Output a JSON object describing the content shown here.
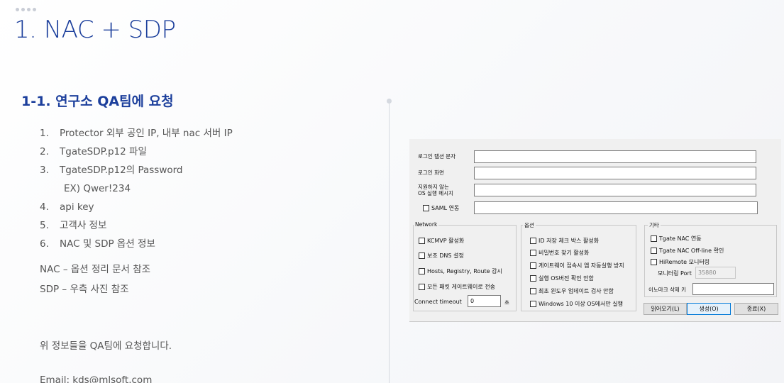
{
  "header": {
    "title": "1. NAC + SDP",
    "subtitle": "1-1. 연구소 QA팀에 요청"
  },
  "list": [
    {
      "num": "1.",
      "text": "Protector 외부 공인 IP, 내부 nac 서버 IP"
    },
    {
      "num": "2.",
      "text": "TgateSDP.p12 파일"
    },
    {
      "num": "3.",
      "text": "TgateSDP.p12의 Password"
    },
    {
      "num": "",
      "text": "EX) Qwer!234"
    },
    {
      "num": "4.",
      "text": "api key"
    },
    {
      "num": "5.",
      "text": "고객사 정보"
    },
    {
      "num": "6.",
      "text": "NAC 및 SDP 옵션 정보"
    }
  ],
  "notes": {
    "nac": "NAC – 옵션 정리 문서 참조",
    "sdp": "SDP – 우측 사진 참조",
    "request": "위 정보들을 QA팀에 요청합니다.",
    "email": "Email: kds@mlsoft.com"
  },
  "dialog": {
    "login_tab_text_label": "로그인 탭션 문자",
    "login_screen_label": "로그인 화면",
    "unsupported_os_label": "지원하지 않는\nOS 실행 메시지",
    "saml_label": "SAML 연동",
    "network": {
      "title": "Network",
      "options": [
        "KCMVP 활성화",
        "보조 DNS 설정",
        "Hosts, Registry, Route 감시",
        "모든 패킷 게이트웨이로 전송"
      ],
      "timeout_label": "Connect timeout",
      "timeout_value": "0",
      "timeout_unit": "초"
    },
    "options": {
      "title": "옵션",
      "items": [
        "ID 저장 체크 박스 활성화",
        "비밀번호 찾기 활성화",
        "게이트웨이 접속시 앱 자동실행 방지",
        "실행 OS버전 확인 안함",
        "최초 윈도우 업데이트 검사 안함",
        "Windows 10 이상 OS에서만 실행"
      ]
    },
    "etc": {
      "title": "기타",
      "items": [
        "Tgate NAC 연동",
        "Tgate NAC Off-line 확인",
        "HiRemote 모니터링"
      ],
      "port_label": "모니터링 Port",
      "port_value": "35880",
      "innomark_label": "이노마크 삭제 키"
    },
    "buttons": {
      "load": "읽어오기(L)",
      "create": "생성(O)",
      "close": "종료(X)"
    }
  }
}
